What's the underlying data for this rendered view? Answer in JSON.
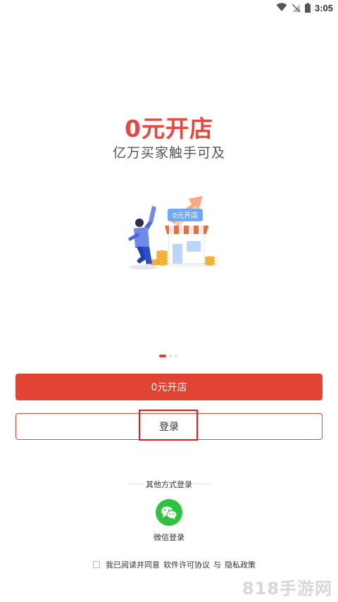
{
  "status_bar": {
    "time": "3:05"
  },
  "hero": {
    "title": "0元开店",
    "subtitle": "亿万买家触手可及",
    "illustration_sign": "0元开店"
  },
  "pager": {
    "pages": 3,
    "active": 0
  },
  "buttons": {
    "open_store": "0元开店",
    "login": "登录"
  },
  "other_login": {
    "title": "其他方式登录",
    "wechat_label": "微信登录"
  },
  "agreement": {
    "prefix": "我已阅读并同意",
    "license": "软件许可协议",
    "and": "与",
    "privacy": "隐私政策"
  },
  "watermark": "818手游网",
  "colors": {
    "accent": "#e04433",
    "title_red": "#e5483f",
    "wechat_green": "#2fc140",
    "highlight": "#d81e1e"
  }
}
